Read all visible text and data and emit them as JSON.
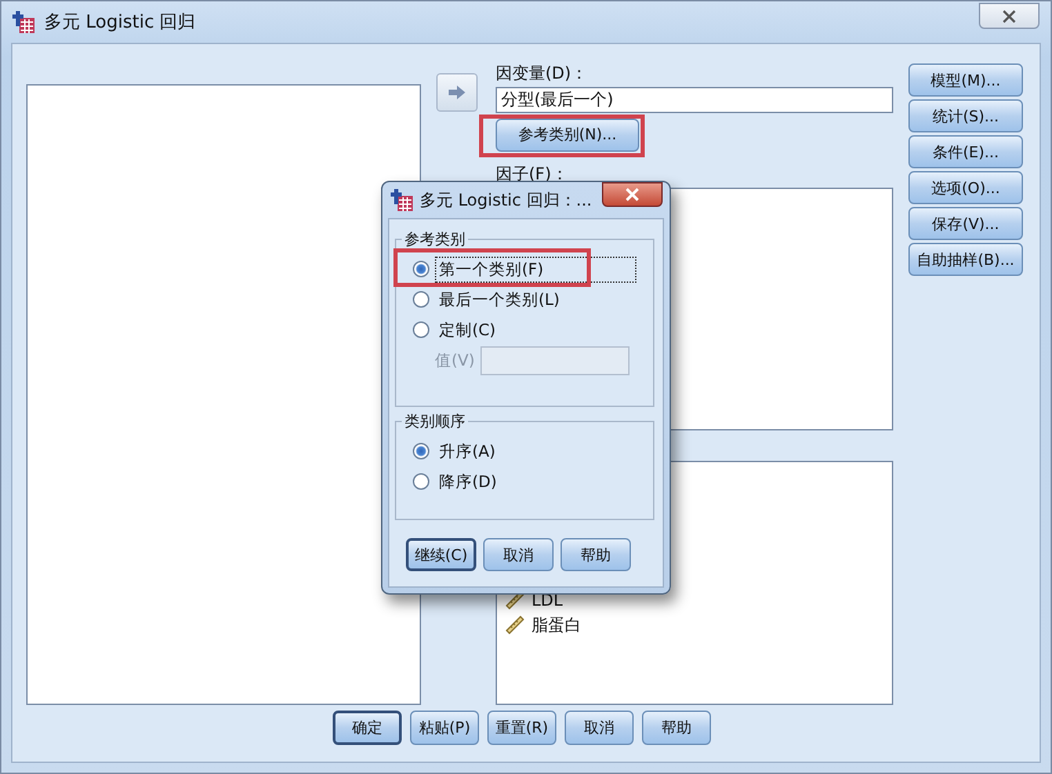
{
  "window": {
    "title": "多元 Logistic 回归"
  },
  "dependent": {
    "label": "因变量(D)：",
    "value": "分型(最后一个)",
    "reference_button": "参考类别(N)...",
    "highlighted": true
  },
  "factors": {
    "label": "因子(F)："
  },
  "covariates": {
    "items": [
      {
        "name": "LDL"
      },
      {
        "name": "脂蛋白"
      }
    ]
  },
  "side_buttons": [
    "模型(M)...",
    "统计(S)...",
    "条件(E)...",
    "选项(O)...",
    "保存(V)...",
    "自助抽样(B)..."
  ],
  "bottom_buttons": [
    {
      "label": "确定",
      "default": true
    },
    {
      "label": "粘贴(P)",
      "default": false
    },
    {
      "label": "重置(R)",
      "default": false
    },
    {
      "label": "取消",
      "default": false
    },
    {
      "label": "帮助",
      "default": false
    }
  ],
  "dialog": {
    "title": "多元 Logistic 回归：...",
    "groups": [
      {
        "title": "参考类别",
        "options": [
          {
            "label": "第一个类别(F)",
            "selected": true,
            "highlighted": true
          },
          {
            "label": "最后一个类别(L)",
            "selected": false,
            "highlighted": false
          },
          {
            "label": "定制(C)",
            "selected": false,
            "highlighted": false
          }
        ],
        "value_field": {
          "label": "值(V)",
          "disabled": true
        }
      },
      {
        "title": "类别顺序",
        "options": [
          {
            "label": "升序(A)",
            "selected": true,
            "highlighted": false
          },
          {
            "label": "降序(D)",
            "selected": false,
            "highlighted": false
          }
        ]
      }
    ],
    "buttons": [
      {
        "label": "继续(C)",
        "default": true
      },
      {
        "label": "取消",
        "default": false
      },
      {
        "label": "帮助",
        "default": false
      }
    ]
  }
}
